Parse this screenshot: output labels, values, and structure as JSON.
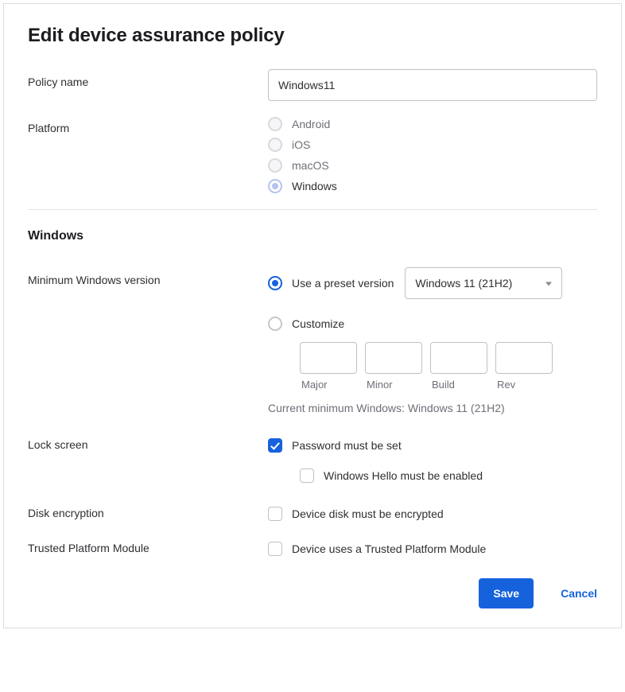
{
  "title": "Edit device assurance policy",
  "fields": {
    "policy_name": {
      "label": "Policy name",
      "value": "Windows11"
    },
    "platform": {
      "label": "Platform",
      "options": [
        "Android",
        "iOS",
        "macOS",
        "Windows"
      ],
      "selected": "Windows"
    }
  },
  "section": {
    "title": "Windows",
    "min_version": {
      "label": "Minimum Windows version",
      "preset_label": "Use a preset version",
      "preset_selected": "Windows 11 (21H2)",
      "customize_label": "Customize",
      "mode": "preset",
      "parts": {
        "major": "Major",
        "minor": "Minor",
        "build": "Build",
        "rev": "Rev"
      },
      "current_text": "Current minimum Windows: Windows 11 (21H2)"
    },
    "lock_screen": {
      "label": "Lock screen",
      "password_label": "Password must be set",
      "password_checked": true,
      "hello_label": "Windows Hello must be enabled",
      "hello_checked": false
    },
    "disk_encryption": {
      "label": "Disk encryption",
      "option_label": "Device disk must be encrypted",
      "checked": false
    },
    "tpm": {
      "label": "Trusted Platform Module",
      "option_label": "Device uses a Trusted Platform Module",
      "checked": false
    }
  },
  "actions": {
    "save": "Save",
    "cancel": "Cancel"
  }
}
